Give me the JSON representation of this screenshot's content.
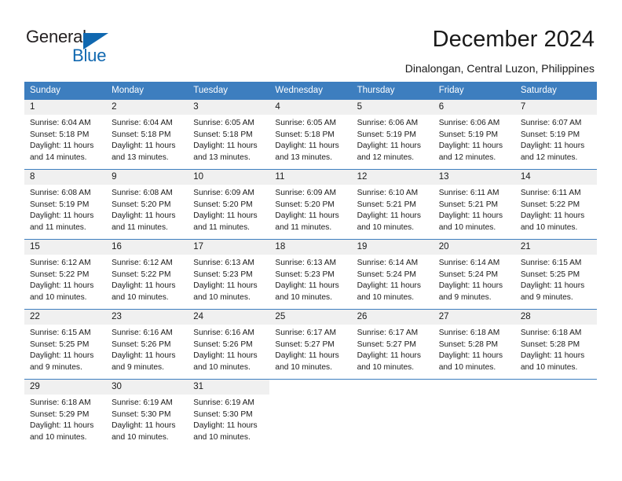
{
  "brand": {
    "word_one": "General",
    "word_two": "Blue",
    "triangle_icon": "triangle-icon",
    "accent_color": "#1068b0"
  },
  "header": {
    "title": "December 2024",
    "subtitle": "Dinalongan, Central Luzon, Philippines"
  },
  "calendar": {
    "header_color": "#3d7ebf",
    "daynum_band_color": "#f0f0f0",
    "weekday_headers": [
      "Sunday",
      "Monday",
      "Tuesday",
      "Wednesday",
      "Thursday",
      "Friday",
      "Saturday"
    ],
    "labels": {
      "sunrise": "Sunrise:",
      "sunset": "Sunset:",
      "daylight": "Daylight:"
    },
    "weeks": [
      [
        {
          "day": "1",
          "sunrise": "Sunrise: 6:04 AM",
          "sunset": "Sunset: 5:18 PM",
          "daylight_line1": "Daylight: 11 hours",
          "daylight_line2": "and 14 minutes."
        },
        {
          "day": "2",
          "sunrise": "Sunrise: 6:04 AM",
          "sunset": "Sunset: 5:18 PM",
          "daylight_line1": "Daylight: 11 hours",
          "daylight_line2": "and 13 minutes."
        },
        {
          "day": "3",
          "sunrise": "Sunrise: 6:05 AM",
          "sunset": "Sunset: 5:18 PM",
          "daylight_line1": "Daylight: 11 hours",
          "daylight_line2": "and 13 minutes."
        },
        {
          "day": "4",
          "sunrise": "Sunrise: 6:05 AM",
          "sunset": "Sunset: 5:18 PM",
          "daylight_line1": "Daylight: 11 hours",
          "daylight_line2": "and 13 minutes."
        },
        {
          "day": "5",
          "sunrise": "Sunrise: 6:06 AM",
          "sunset": "Sunset: 5:19 PM",
          "daylight_line1": "Daylight: 11 hours",
          "daylight_line2": "and 12 minutes."
        },
        {
          "day": "6",
          "sunrise": "Sunrise: 6:06 AM",
          "sunset": "Sunset: 5:19 PM",
          "daylight_line1": "Daylight: 11 hours",
          "daylight_line2": "and 12 minutes."
        },
        {
          "day": "7",
          "sunrise": "Sunrise: 6:07 AM",
          "sunset": "Sunset: 5:19 PM",
          "daylight_line1": "Daylight: 11 hours",
          "daylight_line2": "and 12 minutes."
        }
      ],
      [
        {
          "day": "8",
          "sunrise": "Sunrise: 6:08 AM",
          "sunset": "Sunset: 5:19 PM",
          "daylight_line1": "Daylight: 11 hours",
          "daylight_line2": "and 11 minutes."
        },
        {
          "day": "9",
          "sunrise": "Sunrise: 6:08 AM",
          "sunset": "Sunset: 5:20 PM",
          "daylight_line1": "Daylight: 11 hours",
          "daylight_line2": "and 11 minutes."
        },
        {
          "day": "10",
          "sunrise": "Sunrise: 6:09 AM",
          "sunset": "Sunset: 5:20 PM",
          "daylight_line1": "Daylight: 11 hours",
          "daylight_line2": "and 11 minutes."
        },
        {
          "day": "11",
          "sunrise": "Sunrise: 6:09 AM",
          "sunset": "Sunset: 5:20 PM",
          "daylight_line1": "Daylight: 11 hours",
          "daylight_line2": "and 11 minutes."
        },
        {
          "day": "12",
          "sunrise": "Sunrise: 6:10 AM",
          "sunset": "Sunset: 5:21 PM",
          "daylight_line1": "Daylight: 11 hours",
          "daylight_line2": "and 10 minutes."
        },
        {
          "day": "13",
          "sunrise": "Sunrise: 6:11 AM",
          "sunset": "Sunset: 5:21 PM",
          "daylight_line1": "Daylight: 11 hours",
          "daylight_line2": "and 10 minutes."
        },
        {
          "day": "14",
          "sunrise": "Sunrise: 6:11 AM",
          "sunset": "Sunset: 5:22 PM",
          "daylight_line1": "Daylight: 11 hours",
          "daylight_line2": "and 10 minutes."
        }
      ],
      [
        {
          "day": "15",
          "sunrise": "Sunrise: 6:12 AM",
          "sunset": "Sunset: 5:22 PM",
          "daylight_line1": "Daylight: 11 hours",
          "daylight_line2": "and 10 minutes."
        },
        {
          "day": "16",
          "sunrise": "Sunrise: 6:12 AM",
          "sunset": "Sunset: 5:22 PM",
          "daylight_line1": "Daylight: 11 hours",
          "daylight_line2": "and 10 minutes."
        },
        {
          "day": "17",
          "sunrise": "Sunrise: 6:13 AM",
          "sunset": "Sunset: 5:23 PM",
          "daylight_line1": "Daylight: 11 hours",
          "daylight_line2": "and 10 minutes."
        },
        {
          "day": "18",
          "sunrise": "Sunrise: 6:13 AM",
          "sunset": "Sunset: 5:23 PM",
          "daylight_line1": "Daylight: 11 hours",
          "daylight_line2": "and 10 minutes."
        },
        {
          "day": "19",
          "sunrise": "Sunrise: 6:14 AM",
          "sunset": "Sunset: 5:24 PM",
          "daylight_line1": "Daylight: 11 hours",
          "daylight_line2": "and 10 minutes."
        },
        {
          "day": "20",
          "sunrise": "Sunrise: 6:14 AM",
          "sunset": "Sunset: 5:24 PM",
          "daylight_line1": "Daylight: 11 hours",
          "daylight_line2": "and 9 minutes."
        },
        {
          "day": "21",
          "sunrise": "Sunrise: 6:15 AM",
          "sunset": "Sunset: 5:25 PM",
          "daylight_line1": "Daylight: 11 hours",
          "daylight_line2": "and 9 minutes."
        }
      ],
      [
        {
          "day": "22",
          "sunrise": "Sunrise: 6:15 AM",
          "sunset": "Sunset: 5:25 PM",
          "daylight_line1": "Daylight: 11 hours",
          "daylight_line2": "and 9 minutes."
        },
        {
          "day": "23",
          "sunrise": "Sunrise: 6:16 AM",
          "sunset": "Sunset: 5:26 PM",
          "daylight_line1": "Daylight: 11 hours",
          "daylight_line2": "and 9 minutes."
        },
        {
          "day": "24",
          "sunrise": "Sunrise: 6:16 AM",
          "sunset": "Sunset: 5:26 PM",
          "daylight_line1": "Daylight: 11 hours",
          "daylight_line2": "and 10 minutes."
        },
        {
          "day": "25",
          "sunrise": "Sunrise: 6:17 AM",
          "sunset": "Sunset: 5:27 PM",
          "daylight_line1": "Daylight: 11 hours",
          "daylight_line2": "and 10 minutes."
        },
        {
          "day": "26",
          "sunrise": "Sunrise: 6:17 AM",
          "sunset": "Sunset: 5:27 PM",
          "daylight_line1": "Daylight: 11 hours",
          "daylight_line2": "and 10 minutes."
        },
        {
          "day": "27",
          "sunrise": "Sunrise: 6:18 AM",
          "sunset": "Sunset: 5:28 PM",
          "daylight_line1": "Daylight: 11 hours",
          "daylight_line2": "and 10 minutes."
        },
        {
          "day": "28",
          "sunrise": "Sunrise: 6:18 AM",
          "sunset": "Sunset: 5:28 PM",
          "daylight_line1": "Daylight: 11 hours",
          "daylight_line2": "and 10 minutes."
        }
      ],
      [
        {
          "day": "29",
          "sunrise": "Sunrise: 6:18 AM",
          "sunset": "Sunset: 5:29 PM",
          "daylight_line1": "Daylight: 11 hours",
          "daylight_line2": "and 10 minutes."
        },
        {
          "day": "30",
          "sunrise": "Sunrise: 6:19 AM",
          "sunset": "Sunset: 5:30 PM",
          "daylight_line1": "Daylight: 11 hours",
          "daylight_line2": "and 10 minutes."
        },
        {
          "day": "31",
          "sunrise": "Sunrise: 6:19 AM",
          "sunset": "Sunset: 5:30 PM",
          "daylight_line1": "Daylight: 11 hours",
          "daylight_line2": "and 10 minutes."
        },
        {
          "day": "",
          "sunrise": "",
          "sunset": "",
          "daylight_line1": "",
          "daylight_line2": ""
        },
        {
          "day": "",
          "sunrise": "",
          "sunset": "",
          "daylight_line1": "",
          "daylight_line2": ""
        },
        {
          "day": "",
          "sunrise": "",
          "sunset": "",
          "daylight_line1": "",
          "daylight_line2": ""
        },
        {
          "day": "",
          "sunrise": "",
          "sunset": "",
          "daylight_line1": "",
          "daylight_line2": ""
        }
      ]
    ]
  }
}
